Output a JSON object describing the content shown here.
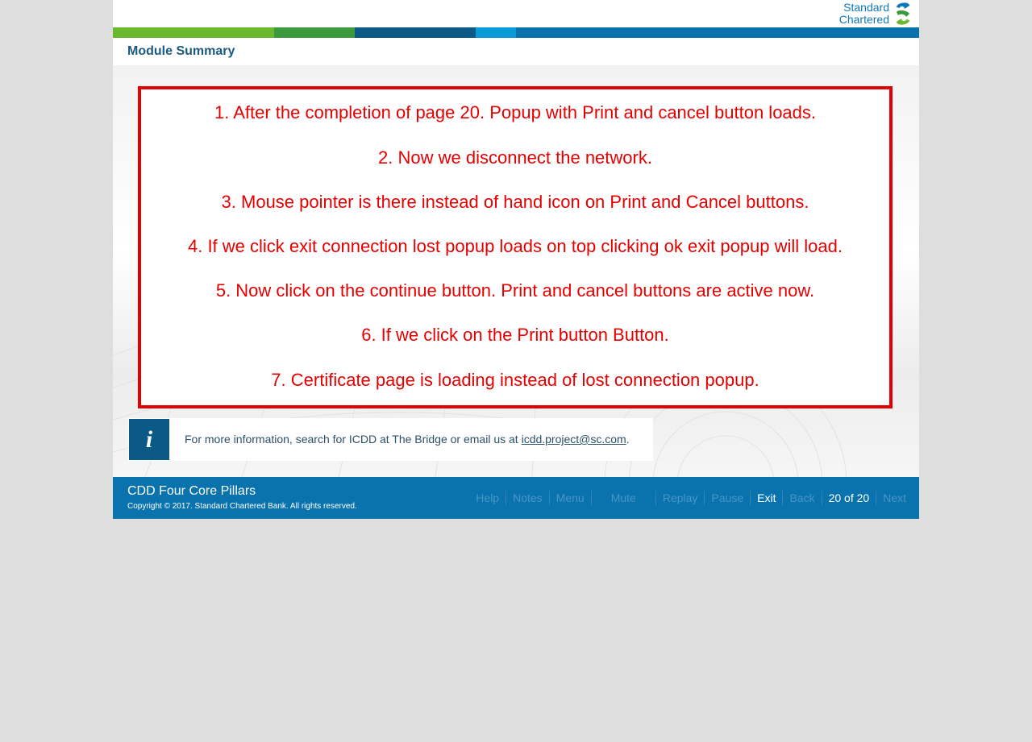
{
  "brand": {
    "logo_line1": "Standard",
    "logo_line2": "Chartered",
    "colors": {
      "green_light": "#6ab82d",
      "green_dark": "#3b9a3c",
      "navy": "#0b5a85",
      "cyan": "#0a9ad8",
      "blue": "#0a73ad",
      "red": "#e30000"
    }
  },
  "header": {
    "module_title": "Module Summary"
  },
  "notes": [
    "1. After the completion of page 20. Popup with Print and cancel button loads.",
    "2. Now we disconnect the network.",
    "3. Mouse pointer is there instead of hand icon on Print and Cancel buttons.",
    "4. If we click exit connection lost popup loads on top clicking ok exit popup will load.",
    "5. Now click on the continue button. Print and cancel buttons are active now.",
    "6. If we click on the Print button Button.",
    "7. Certificate page is loading instead of lost connection popup."
  ],
  "info": {
    "icon": "info-icon",
    "text_before": "For more information, search for ICDD at The Bridge or email us at ",
    "email": "icdd.project@sc.com",
    "text_after": "."
  },
  "footer": {
    "course_title": "CDD Four Core Pillars",
    "copyright": "Copyright © 2017. Standard Chartered Bank. All rights reserved.",
    "nav": {
      "help": "Help",
      "notes": "Notes",
      "menu": "Menu",
      "mute": "Mute",
      "replay": "Replay",
      "pause": "Pause",
      "exit": "Exit",
      "back": "Back",
      "page_counter": "20 of 20",
      "next": "Next"
    }
  }
}
